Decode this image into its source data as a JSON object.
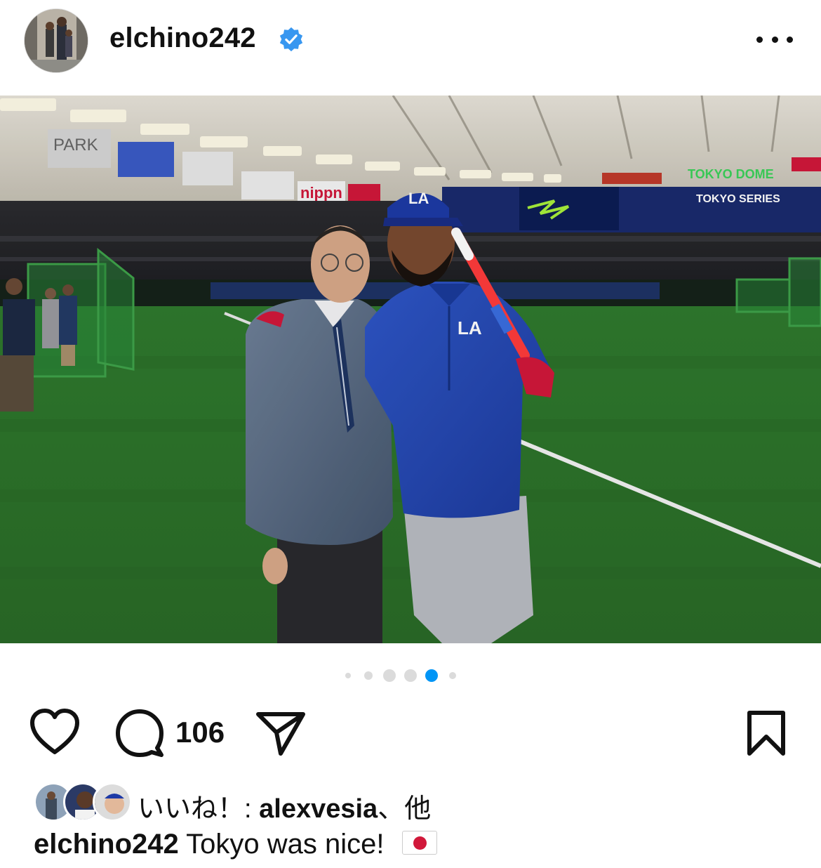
{
  "post": {
    "username": "elchino242",
    "verified": true,
    "icons": {
      "verified": "verified-badge-icon",
      "more": "more-options-icon",
      "like": "heart-icon",
      "comment": "comment-bubble-icon",
      "share": "paper-plane-icon",
      "save": "bookmark-icon"
    },
    "colors": {
      "verified_blue": "#3897f0",
      "active_dot": "#0095f6",
      "inactive_dot": "#dbdbdb",
      "flag_red": "#d1183a"
    }
  },
  "photo": {
    "description_label": "photo",
    "signage": [
      "PARK",
      "nippn",
      "TOKYO DOME",
      "TOKYO SERIES",
      "LA"
    ]
  },
  "carousel": {
    "total": 6,
    "active_index": 4
  },
  "actions": {
    "comment_count": "106"
  },
  "likes": {
    "prefix": "いいね！: ",
    "user": "alexvesia",
    "suffix": "、他"
  },
  "caption": {
    "username": "elchino242",
    "text": "Tokyo was nice!",
    "flag": "japan-flag-icon"
  }
}
